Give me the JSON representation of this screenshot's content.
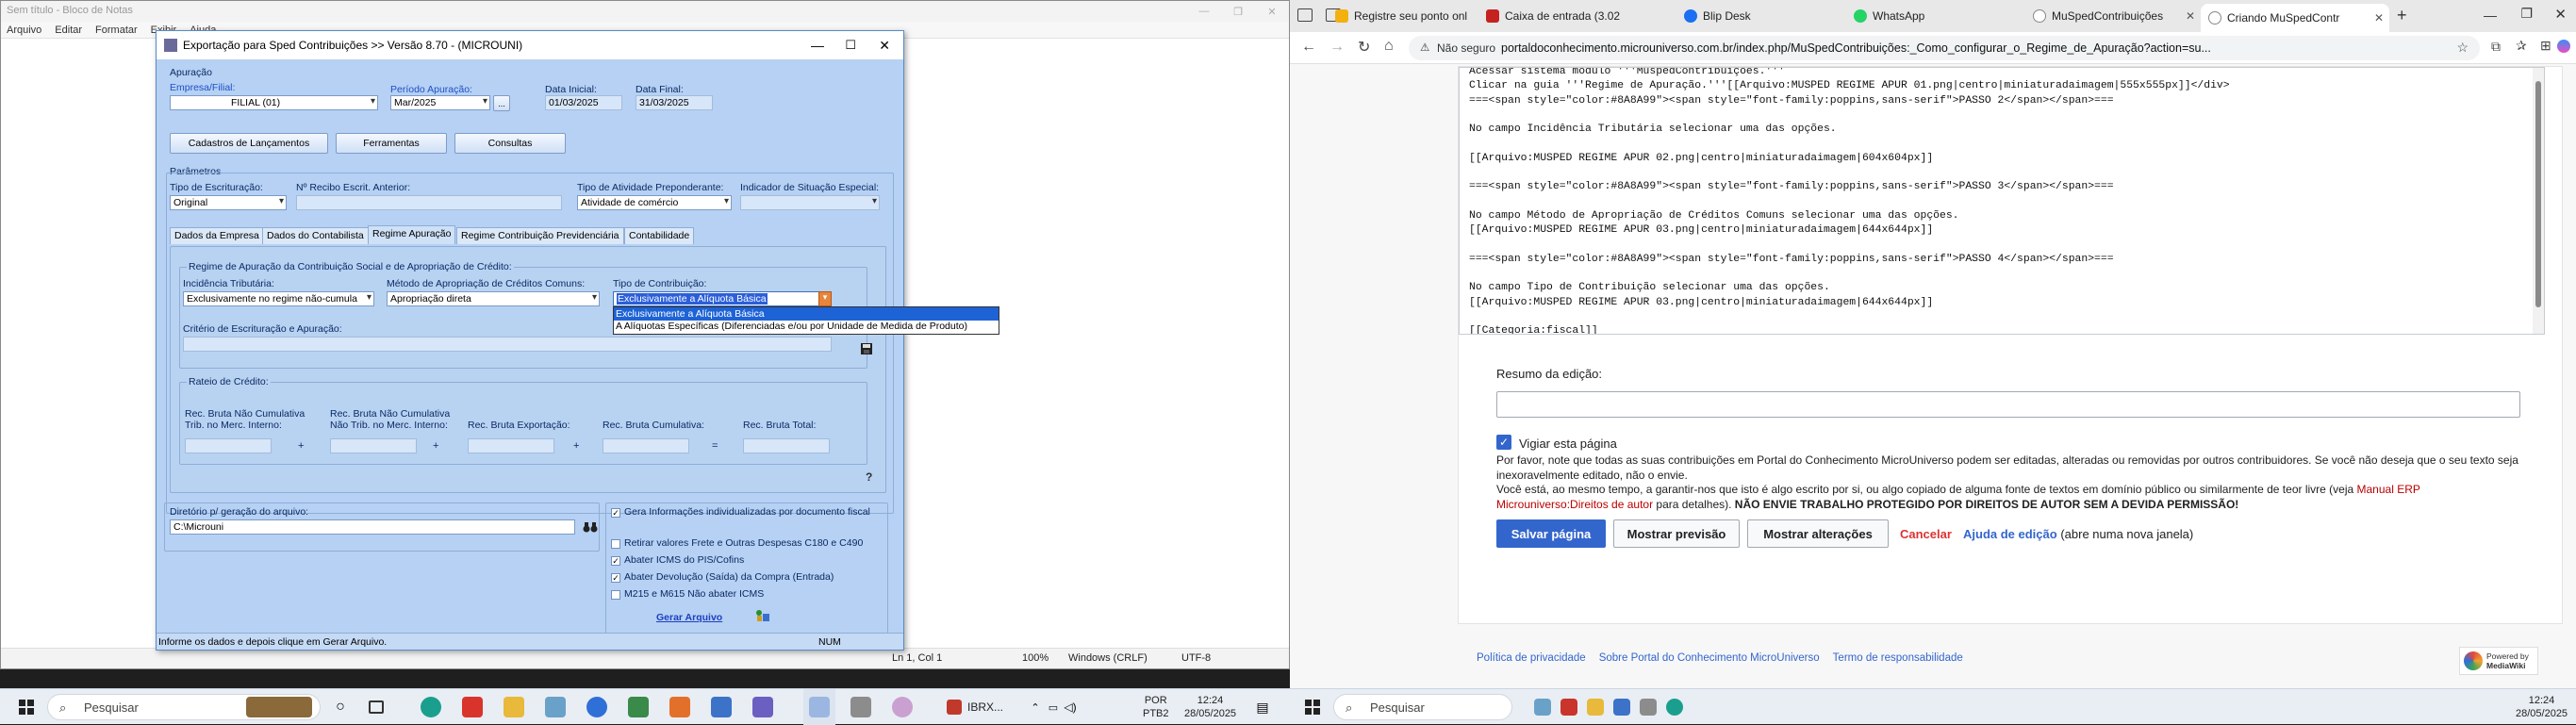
{
  "notepad": {
    "title": "Sem título - Bloco de Notas",
    "menu": [
      "Arquivo",
      "Editar",
      "Formatar",
      "Exibir",
      "Ajuda"
    ],
    "status": {
      "position": "Ln 1, Col 1",
      "zoom": "100%",
      "line_ending": "Windows (CRLF)",
      "encoding": "UTF-8"
    }
  },
  "dialog": {
    "title": "Exportação para Sped Contribuições >> Versão 8.70 - (MICROUNI)",
    "apuracao": {
      "group_label": "Apuração",
      "empresa_label": "Empresa/Filial:",
      "empresa_value": "FILIAL (01)",
      "periodo_label": "Período Apuração:",
      "periodo_value": "Mar/2025",
      "ellipsis_button": "...",
      "data_inicial_label": "Data Inicial:",
      "data_inicial_value": "01/03/2025",
      "data_final_label": "Data Final:",
      "data_final_value": "31/03/2025"
    },
    "buttons": {
      "cadastros": "Cadastros de Lançamentos",
      "ferramentas": "Ferramentas",
      "consultas": "Consultas",
      "gerar": "Gerar Arquivo"
    },
    "parametros": {
      "group_label": "Parâmetros",
      "tipo_escrituracao_label": "Tipo de Escrituração:",
      "tipo_escrituracao_value": "Original",
      "recibo_label": "Nº Recibo Escrit. Anterior:",
      "atividade_label": "Tipo de Atividade Preponderante:",
      "atividade_value": "Atividade de comércio",
      "situacao_label": "Indicador de Situação Especial:"
    },
    "tabs": [
      "Dados da Empresa",
      "Dados do Contabilista",
      "Regime Apuração",
      "Regime Contribuição Previdenciária",
      "Contabilidade"
    ],
    "active_tab": "Regime Apuração",
    "regime": {
      "group_label": "Regime de Apuração da Contribuição Social e de Apropriação de Crédito:",
      "incidencia_label": "Incidência Tributária:",
      "incidencia_value": "Exclusivamente no regime não-cumula",
      "metodo_label": "Método de Apropriação de Créditos Comuns:",
      "metodo_value": "Apropriação direta",
      "tipo_contribuicao_label": "Tipo de Contribuição:",
      "tipo_contribuicao_value": "Exclusivamente a Alíquota Básica",
      "dropdown_options": [
        "Exclusivamente a Alíquota Básica",
        "A Alíquotas Específicas (Diferenciadas e/ou por Unidade de Medida de Produto)"
      ],
      "criterio_label": "Critério de Escrituração e Apuração:"
    },
    "rateio": {
      "group_label": "Rateio de Crédito:",
      "col1": "Rec. Bruta Não Cumulativa Trib. no Merc. Interno:",
      "col2": "Rec. Bruta Não Cumulativa Não Trib. no Merc. Interno:",
      "col3": "Rec. Bruta Exportação:",
      "col4": "Rec. Bruta Cumulativa:",
      "col5": "Rec. Bruta Total:",
      "plus": "+",
      "equals": "="
    },
    "diretorio": {
      "label": "Diretório p/ geração do arquivo:",
      "value": "C:\\Microuni"
    },
    "options": [
      {
        "label": "Gera Informações individualizadas por documento fiscal",
        "checked": true
      },
      {
        "label": "Retirar valores Frete e Outras Despesas C180 e C490",
        "checked": false
      },
      {
        "label": "Abater ICMS do PIS/Cofins",
        "checked": true
      },
      {
        "label": "Abater Devolução (Saída) da Compra (Entrada)",
        "checked": true
      },
      {
        "label": "M215 e M615 Não abater ICMS",
        "checked": false
      }
    ],
    "status_text": "Informe os dados e depois clique em Gerar Arquivo.",
    "status_num": "NUM"
  },
  "taskbar_left": {
    "search_placeholder": "Pesquisar",
    "ibrx_label": "IBRX...",
    "lang": "POR",
    "layout": "PTB2",
    "time": "12:24",
    "date": "28/05/2025"
  },
  "edge": {
    "tabs": [
      {
        "title": "Registre seu ponto onl",
        "color": "#f3b10f"
      },
      {
        "title": "Caixa de entrada (3.02",
        "color": "#c5221f"
      },
      {
        "title": "Blip Desk",
        "color": "#1c6ef2"
      },
      {
        "title": "WhatsApp",
        "color": "#25d366"
      },
      {
        "title": "MuSpedContribuições",
        "color": "#999999"
      },
      {
        "title": "Criando MuSpedContr",
        "color": "#999999"
      }
    ],
    "security": "Não seguro",
    "url": "portaldoconhecimento.microuniverso.com.br/index.php/MuSpedContribuições:_Como_configurar_o_Regime_de_Apuração?action=su...",
    "editor_lines": [
      "Acessar sistema módulo '''MuspedContribuições.'''",
      "",
      "Clicar na guia '''Regime de Apuração.'''[[Arquivo:MUSPED REGIME APUR 01.png|centro|miniaturadaimagem|555x555px]]</div>",
      "===<span style=\"color:#8A8A99\"><span style=\"font-family:poppins,sans-serif\">PASSO 2</span></span>===",
      "",
      "No campo Incidência Tributária selecionar uma das opções.",
      "",
      "[[Arquivo:MUSPED REGIME APUR 02.png|centro|miniaturadaimagem|604x604px]]",
      "",
      "===<span style=\"color:#8A8A99\"><span style=\"font-family:poppins,sans-serif\">PASSO 3</span></span>===",
      "",
      "No campo Método de Apropriação de Créditos Comuns selecionar uma das opções.",
      "[[Arquivo:MUSPED REGIME APUR 03.png|centro|miniaturadaimagem|644x644px]]",
      "",
      "===<span style=\"color:#8A8A99\"><span style=\"font-family:poppins,sans-serif\">PASSO 4</span></span>===",
      "",
      "No campo Tipo de Contribuição selecionar uma das opções.",
      "[[Arquivo:MUSPED REGIME APUR 03.png|centro|miniaturadaimagem|644x644px]]",
      "",
      "[[Categoria:fiscal]]"
    ],
    "resumo_label": "Resumo da edição:",
    "vigiar_label": "Vigiar esta página",
    "notice_1": "Por favor, note que todas as suas contribuições em Portal do Conhecimento MicroUniverso podem ser editadas, alteradas ou removidas por outros contribuidores. Se você não deseja que o seu texto seja inexoravelmente editado, não o envie.",
    "notice_2a": "Você está, ao mesmo tempo, a garantir-nos que isto é algo escrito por si, ou algo copiado de alguma fonte de textos em domínio público ou similarmente de teor livre (veja ",
    "notice_2_link": "Manual ERP Microuniverso:Direitos de autor",
    "notice_2b": " para detalhes). ",
    "notice_bold": "NÃO ENVIE TRABALHO PROTEGIDO POR DIREITOS DE AUTOR SEM A DEVIDA PERMISSÃO!",
    "save_button": "Salvar página",
    "preview_button": "Mostrar previsão",
    "changes_button": "Mostrar alterações",
    "cancel_link": "Cancelar",
    "help_link": "Ajuda de edição",
    "help_note": "(abre numa nova janela)",
    "footer_links": [
      "Política de privacidade",
      "Sobre Portal do Conhecimento MicroUniverso",
      "Termo de responsabilidade"
    ],
    "powered_line1": "Powered by",
    "powered_line2": "MediaWiki"
  },
  "taskbar_right": {
    "search_placeholder": "Pesquisar",
    "time": "12:24",
    "date": "28/05/2025"
  }
}
